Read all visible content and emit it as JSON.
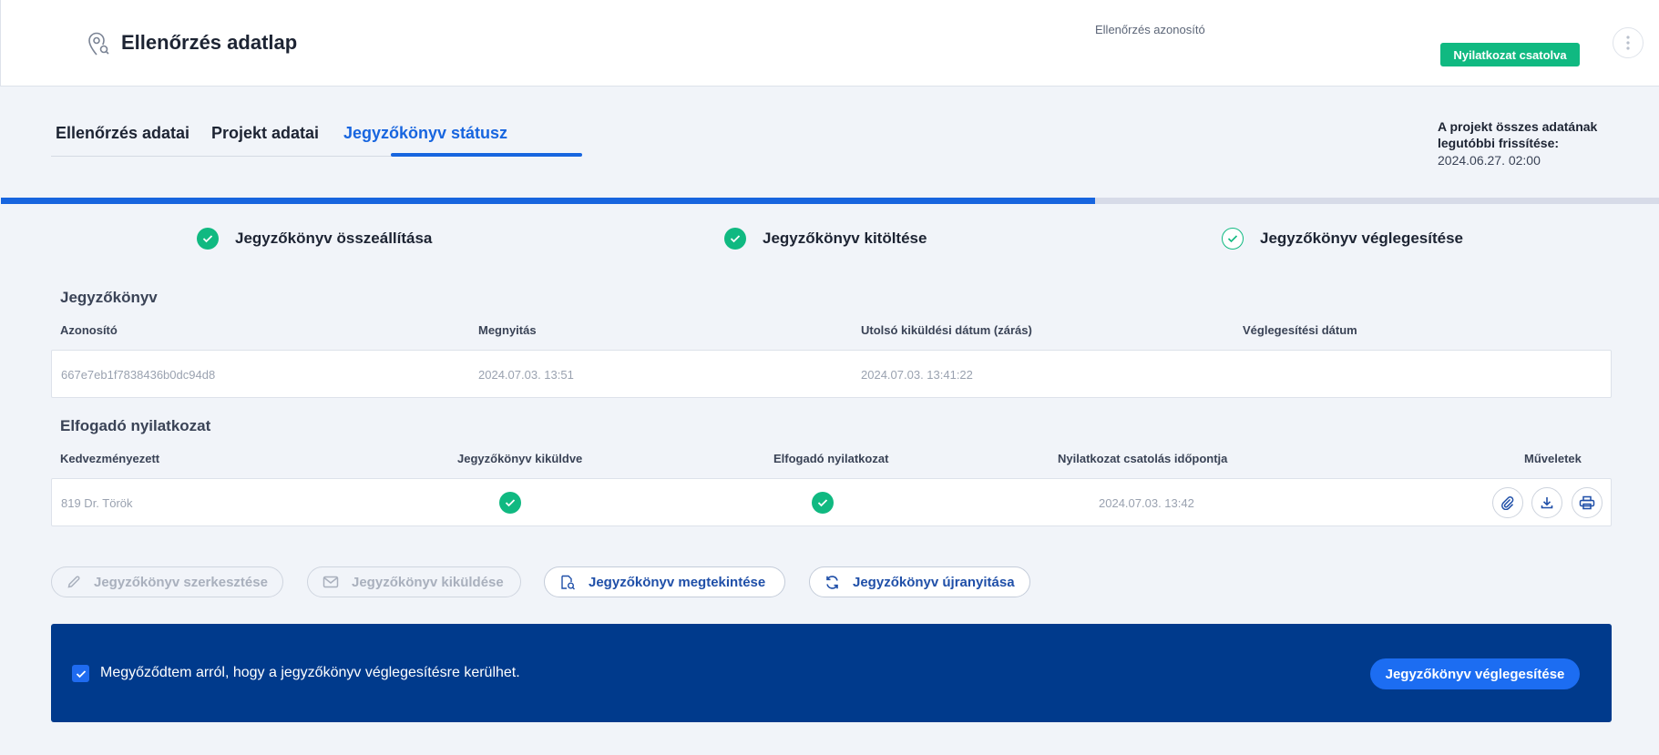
{
  "header": {
    "title": "Ellenőrzés adatlap",
    "id_label": "Ellenőrzés azonosító",
    "badge": "Nyilatkozat csatolva"
  },
  "tabs": [
    {
      "label": "Ellenőrzés adatai"
    },
    {
      "label": "Projekt adatai"
    },
    {
      "label": "Jegyzőkönyv státusz",
      "active": true
    }
  ],
  "refresh": {
    "label": "A projekt összes adatának legutóbbi frissítése:",
    "value": "2024.06.27. 02:00"
  },
  "progress": {
    "fraction": 0.66
  },
  "steps": [
    {
      "label": "Jegyzőkönyv összeállítása",
      "state": "done"
    },
    {
      "label": "Jegyzőkönyv kitöltése",
      "state": "done"
    },
    {
      "label": "Jegyzőkönyv véglegesítése",
      "state": "current"
    }
  ],
  "protocol": {
    "title": "Jegyzőkönyv",
    "headers": [
      "Azonosító",
      "Megnyitás",
      "Utolsó kiküldési dátum (zárás)",
      "Véglegesítési dátum"
    ],
    "row": [
      "667e7eb1f7838436b0dc94d8",
      "2024.07.03. 13:51",
      "2024.07.03. 13:41:22",
      ""
    ]
  },
  "acceptance": {
    "title": "Elfogadó nyilatkozat",
    "headers": [
      "Kedvezményezett",
      "Jegyzőkönyv kiküldve",
      "Elfogadó nyilatkozat",
      "Nyilatkozat csatolás időpontja",
      "Műveletek"
    ],
    "row": {
      "beneficiary": "819 Dr. Török",
      "sent": true,
      "accepted": true,
      "attached_at": "2024.07.03. 13:42"
    }
  },
  "actions": [
    {
      "label": "Jegyzőkönyv szerkesztése",
      "enabled": false,
      "icon": "pencil-icon"
    },
    {
      "label": "Jegyzőkönyv kiküldése",
      "enabled": false,
      "icon": "envelope-icon"
    },
    {
      "label": "Jegyzőkönyv megtekintése",
      "enabled": true,
      "icon": "document-view-icon"
    },
    {
      "label": "Jegyzőkönyv újranyitása",
      "enabled": true,
      "icon": "refresh-icon"
    }
  ],
  "confirm": {
    "text": "Megyőződtem arról, hogy a jegyzőkönyv véglegesítésre kerülhet.",
    "checked": true,
    "button": "Jegyzőkönyv véglegesítése"
  },
  "colors": {
    "primary": "#1765df",
    "success": "#10b981",
    "banner": "#003a8c"
  }
}
